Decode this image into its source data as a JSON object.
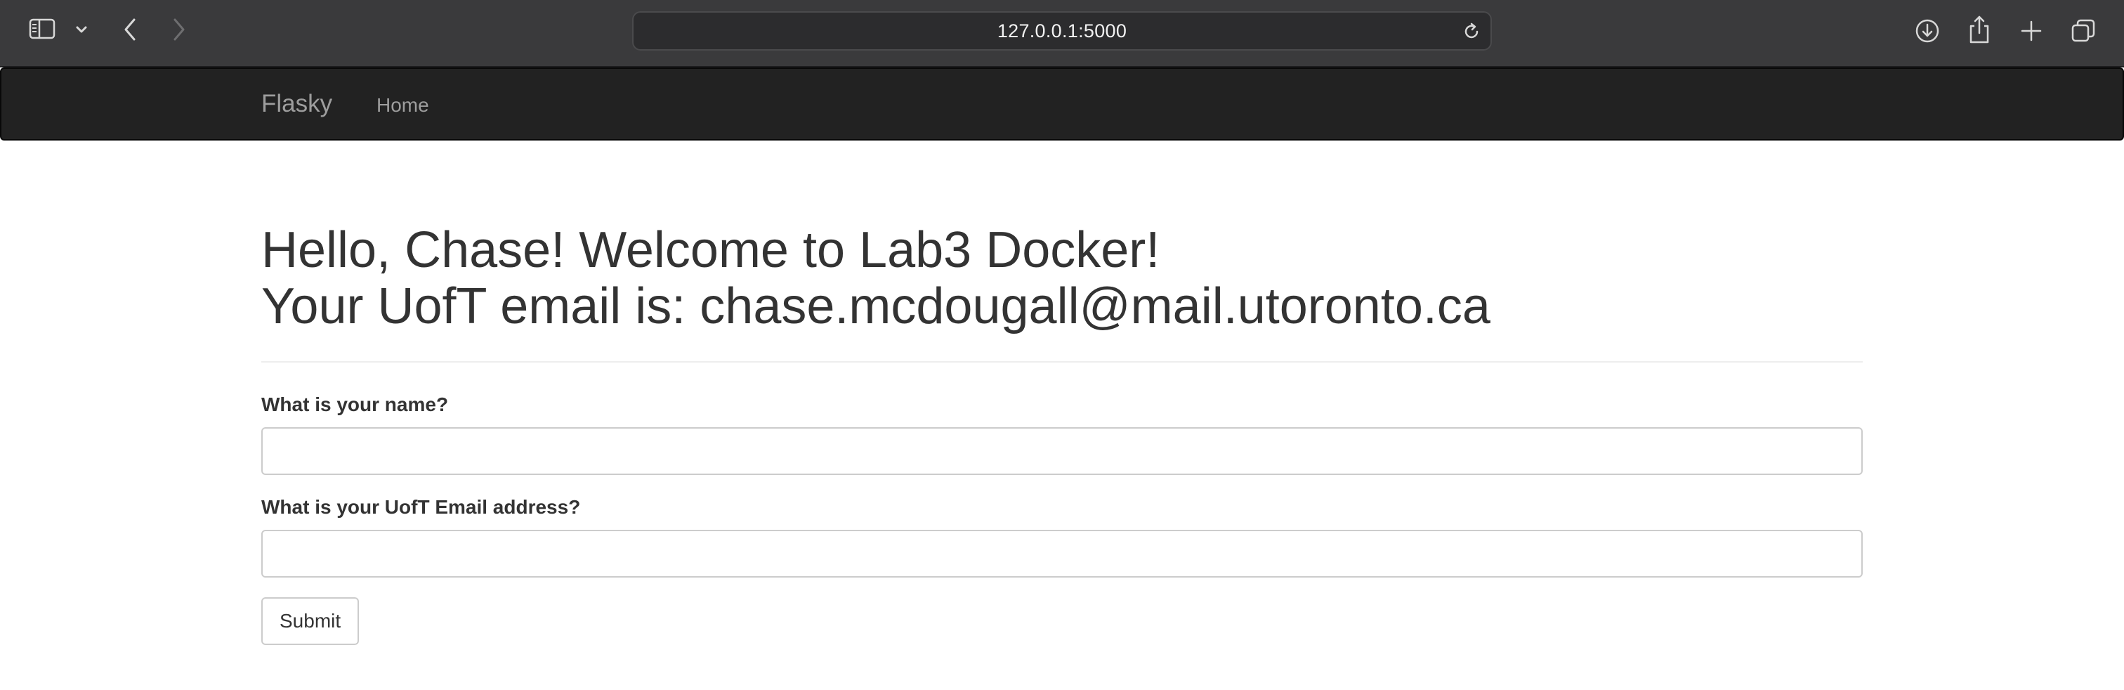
{
  "browser": {
    "url": "127.0.0.1:5000",
    "icons": {
      "sidebar": "sidebar-icon",
      "sidebar_menu": "chevron-down-icon",
      "back": "chevron-left-icon",
      "forward": "chevron-right-icon",
      "reload": "reload-icon",
      "downloads": "download-icon",
      "share": "share-icon",
      "new_tab": "plus-icon",
      "tab_overview": "tabs-icon"
    }
  },
  "navbar": {
    "brand": "Flasky",
    "links": [
      {
        "label": "Home"
      }
    ]
  },
  "page": {
    "heading_line1": "Hello, Chase! Welcome to Lab3 Docker!",
    "heading_line2": "Your UofT email is: chase.mcdougall@mail.utoronto.ca"
  },
  "form": {
    "name_label": "What is your name?",
    "name_value": "",
    "email_label": "What is your UofT Email address?",
    "email_value": "",
    "submit_label": "Submit"
  },
  "colors": {
    "chrome_bg": "#3a3a3c",
    "navbar_bg": "#222222",
    "navbar_text": "#9d9d9d",
    "heading_text": "#333333"
  }
}
